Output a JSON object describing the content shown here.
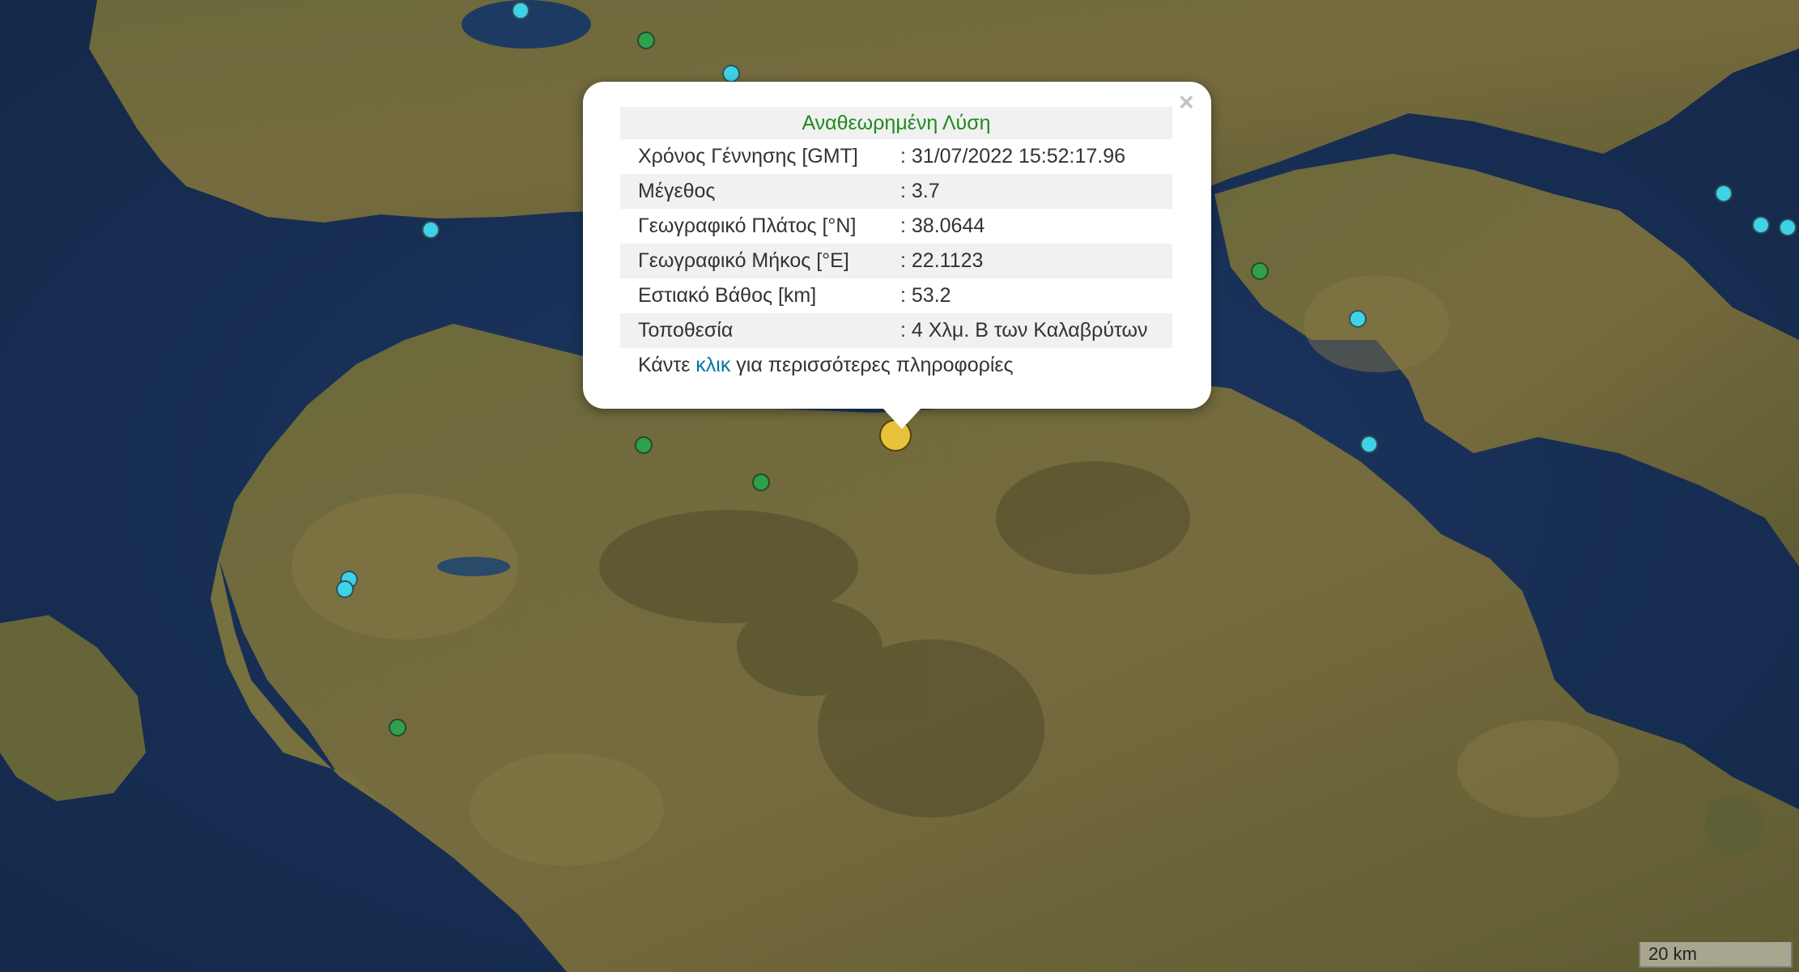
{
  "popup": {
    "title": "Αναθεωρημένη Λύση",
    "close_glyph": "×",
    "rows": [
      {
        "label": "Χρόνος Γέννησης [GMT]",
        "value": ": 31/07/2022 15:52:17.96"
      },
      {
        "label": "Μέγεθος",
        "value": ": 3.7"
      },
      {
        "label": "Γεωγραφικό Πλάτος [°N]",
        "value": ": 38.0644"
      },
      {
        "label": "Γεωγραφικό Μήκος [°E]",
        "value": ": 22.1123"
      },
      {
        "label": "Εστιακό Βάθος [km]",
        "value": ": 53.2"
      },
      {
        "label": "Τοποθεσία",
        "value": ": 4 Χλμ. Β των Καλαβρύτων"
      }
    ],
    "footer_before": "Κάντε ",
    "footer_link": "κλικ",
    "footer_after": " για περισσότερες πληροφορίες"
  },
  "scale": {
    "label": "20 km"
  },
  "colors": {
    "marker_cyan": "#3fd2e6",
    "marker_green": "#2fa14a",
    "marker_selected": "#e8c23a",
    "sea": "#182f55",
    "land": "#6f6a3a"
  }
}
